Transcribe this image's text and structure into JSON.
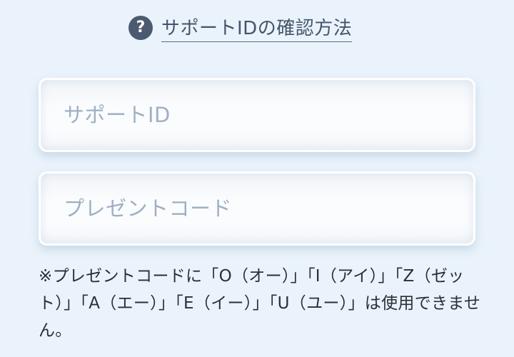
{
  "help": {
    "icon": "question-circle-icon",
    "link_text": "サポートIDの確認方法"
  },
  "form": {
    "support_id": {
      "placeholder": "サポートID",
      "value": ""
    },
    "present_code": {
      "placeholder": "プレゼントコード",
      "value": ""
    }
  },
  "note": "※プレゼントコードに「O（オー）」「I（アイ）」「Z（ゼット）」「A（エー）」「E（イー）」「U（ユー）」は使用できません。",
  "colors": {
    "background": "#eaf3fb",
    "link_text": "#44546a",
    "icon_bg": "#4b5a70",
    "placeholder": "#9fb0c3",
    "note_text": "#2b2f36"
  }
}
